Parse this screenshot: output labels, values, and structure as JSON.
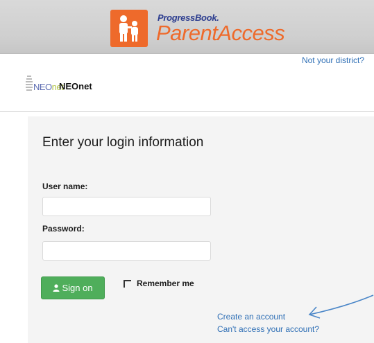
{
  "brand": {
    "small_text": "ProgressBook.",
    "app_name": "ParentAccess",
    "logo_icon": "parent-child-icon",
    "accent_color": "#ee6a2b"
  },
  "district": {
    "not_your_district": "Not your district?",
    "logo_text_a": "NEO",
    "logo_text_b": "net",
    "name": "NEOnet"
  },
  "login": {
    "title": "Enter your login information",
    "username_label": "User name:",
    "username_value": "",
    "password_label": "Password:",
    "password_value": "",
    "sign_on_label": "Sign on",
    "sign_on_icon": "user-icon",
    "sign_on_color": "#4fae5b",
    "remember_label": "Remember me",
    "remember_checked": false
  },
  "links": {
    "create_account": "Create an account",
    "cant_access": "Can't access your account?",
    "link_color": "#2f6fb5"
  },
  "annotation": {
    "arrow_color": "#4a86c8"
  }
}
